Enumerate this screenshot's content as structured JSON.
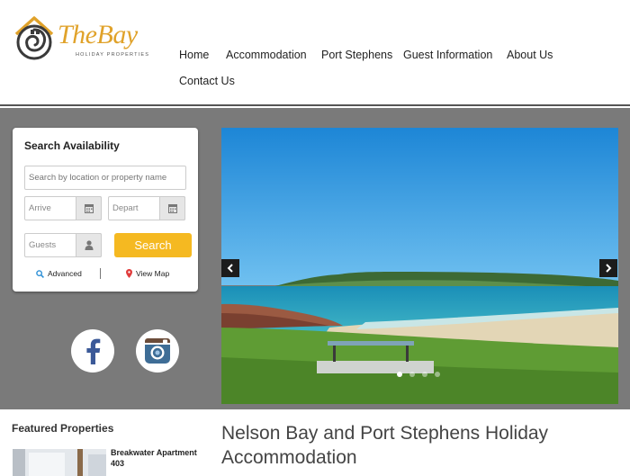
{
  "brand": {
    "name": "TheBay",
    "tagline": "HOLIDAY PROPERTIES",
    "colors": {
      "gold": "#e0a22a",
      "dark": "#3a3a3a"
    }
  },
  "nav": {
    "items": [
      "Home",
      "Accommodation",
      "Port Stephens",
      "Guest Information",
      "About Us",
      "Contact Us"
    ]
  },
  "search": {
    "title": "Search Availability",
    "location_placeholder": "Search by location or property name",
    "arrive_placeholder": "Arrive",
    "depart_placeholder": "Depart",
    "guests_placeholder": "Guests",
    "search_label": "Search",
    "advanced_label": "Advanced",
    "map_label": "View Map",
    "icons": {
      "arrive": "calendar-icon",
      "depart": "calendar-icon",
      "guests": "user-icon",
      "advanced": "search-icon",
      "map": "map-pin-icon"
    },
    "accent": "#f5b921"
  },
  "social": {
    "icons": [
      "facebook-icon",
      "instagram-icon"
    ]
  },
  "slider": {
    "slide_count": 4,
    "active_slide": 1,
    "icons": {
      "prev": "chevron-left-icon",
      "next": "chevron-right-icon"
    }
  },
  "featured": {
    "title": "Featured Properties",
    "items": [
      {
        "name": "Breakwater Apartment 403"
      }
    ]
  },
  "main": {
    "heading": "Nelson Bay and Port Stephens Holiday Accommodation"
  }
}
